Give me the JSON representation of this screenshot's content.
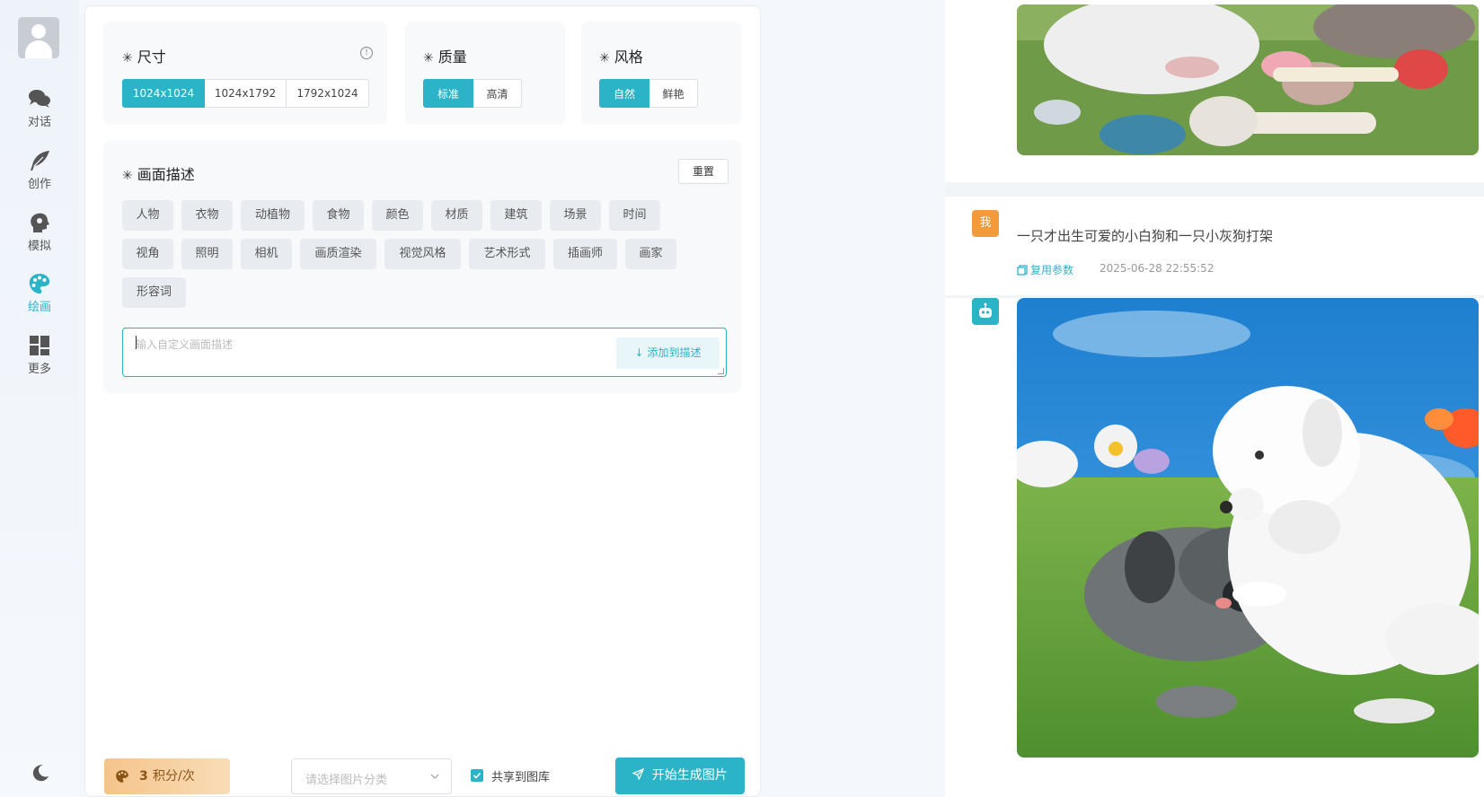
{
  "sidebar": {
    "items": [
      {
        "label": "对话",
        "icon": "chat-bubbles-icon"
      },
      {
        "label": "创作",
        "icon": "feather-icon"
      },
      {
        "label": "模拟",
        "icon": "head-profile-icon"
      },
      {
        "label": "绘画",
        "icon": "palette-icon",
        "active": true
      },
      {
        "label": "更多",
        "icon": "grid-icon"
      }
    ],
    "theme_icon": "moon-icon"
  },
  "size": {
    "title": "尺寸",
    "options": [
      "1024x1024",
      "1024x1792",
      "1792x1024"
    ],
    "selected": "1024x1024"
  },
  "quality": {
    "title": "质量",
    "options": [
      "标准",
      "高清"
    ],
    "selected": "标准"
  },
  "style": {
    "title": "风格",
    "options": [
      "自然",
      "鲜艳"
    ],
    "selected": "自然"
  },
  "description": {
    "title": "画面描述",
    "reset_label": "重置",
    "tags": [
      "人物",
      "衣物",
      "动植物",
      "食物",
      "颜色",
      "材质",
      "建筑",
      "场景",
      "时间",
      "视角",
      "照明",
      "相机",
      "画质渲染",
      "视觉风格",
      "艺术形式",
      "插画师",
      "画家",
      "形容词"
    ],
    "input_placeholder": "输入自定义画面描述",
    "add_label": "添加到描述"
  },
  "footer": {
    "points_value": "3",
    "points_unit": "积分/次",
    "category_placeholder": "请选择图片分类",
    "share_label": "共享到图库",
    "share_checked": true,
    "generate_label": "开始生成图片"
  },
  "chat": {
    "user_badge": "我",
    "user_prompt": "一只才出生可爱的小白狗和一只小灰狗打架",
    "reuse_label": "复用参数",
    "timestamp": "2025-06-28 22:55:52",
    "accent": "#2bb3c8",
    "user_badge_color": "#f39a3b"
  }
}
